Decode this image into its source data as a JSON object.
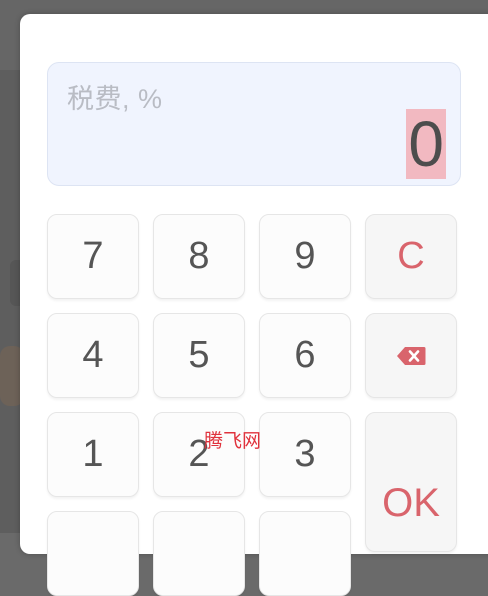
{
  "display": {
    "label": "税费, %",
    "value": "0"
  },
  "keypad": {
    "row1": [
      "7",
      "8",
      "9"
    ],
    "row2": [
      "4",
      "5",
      "6"
    ],
    "row3": [
      "1",
      "2",
      "3"
    ],
    "clear_label": "C",
    "ok_label": "OK",
    "backspace_icon": "backspace-icon"
  },
  "watermark": {
    "text": "腾飞网"
  },
  "colors": {
    "accent": "#d9646c",
    "display_bg": "#f0f4fe",
    "value_highlight": "#f2b9c1"
  }
}
